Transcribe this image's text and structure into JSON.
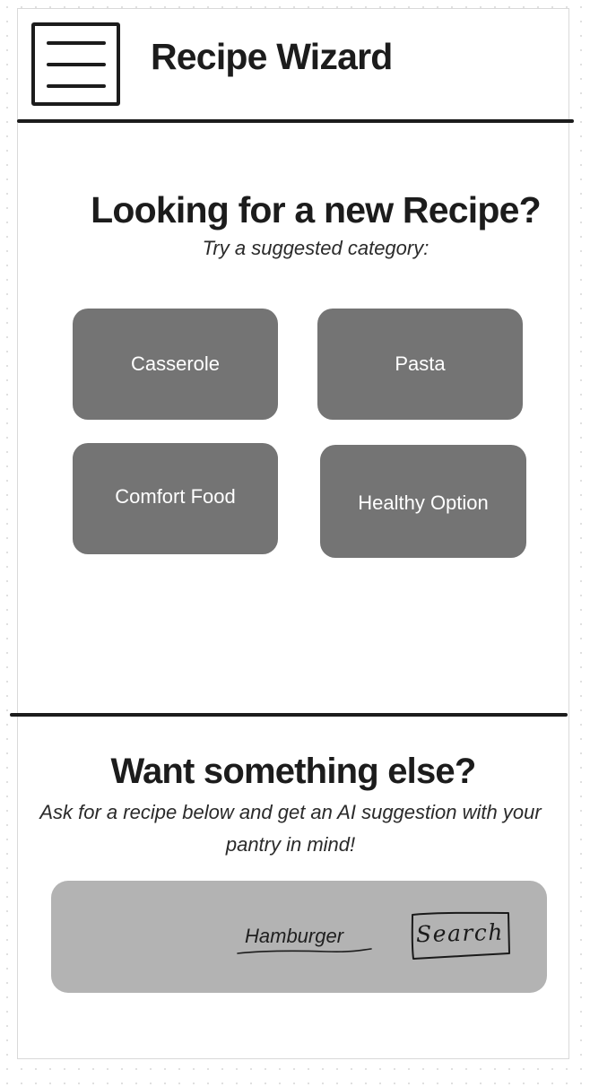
{
  "header": {
    "menu_icon": "hamburger-menu-icon",
    "title": "Recipe Wizard"
  },
  "suggestions": {
    "heading": "Looking for a new Recipe?",
    "subheading": "Try a suggested category:",
    "categories": [
      {
        "label": "Casserole"
      },
      {
        "label": "Pasta"
      },
      {
        "label": "Comfort Food"
      },
      {
        "label": "Healthy Option"
      }
    ]
  },
  "ai_search": {
    "heading": "Want something else?",
    "description": "Ask for a recipe below and get an AI suggestion with your pantry in mind!",
    "query_value": "Hamburger",
    "search_label": "Search"
  },
  "colors": {
    "category_button": "#747474",
    "search_panel": "#b3b3b3",
    "ink": "#1c1c1c"
  }
}
